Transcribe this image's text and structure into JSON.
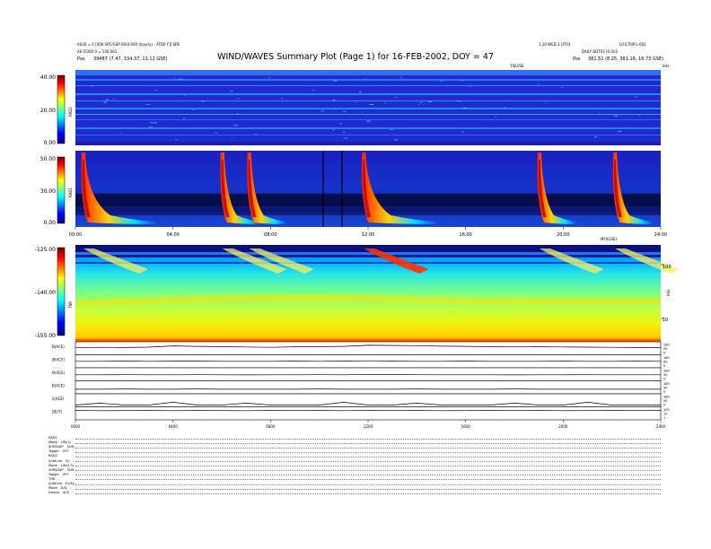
{
  "header": {
    "left_line1": "A036 = 0 [000 SPC/GSP 00(0 000 (hourly) - ATD0 F][ SPE",
    "left_line2": "A0 [F000 0 = 136.061",
    "left_pos_label": "Pos",
    "left_pos_value": "39487 (7.47, 334.37, 11.12 GSE)",
    "title": "WIND/WAVES Summary Plot (Page 1) for 16-FEB-2002, DOY = 47",
    "right_line1": "1.10 WED 3 UT03",
    "right_line1b": "L0 E700Fu 601",
    "right_line2": "DAILY BDT03 [0.0(i2",
    "right_pos_label": "Pos",
    "right_pos_value": "381.51 (8.25, 381.16, 16.73 GSE)",
    "units_label": "TIEU/SE",
    "unit_right": "kHz"
  },
  "footer_rows": [
    {
      "label": "RAD1",
      "value": ""
    },
    {
      "label": "Mode",
      "value": "LIN(1)"
    },
    {
      "label": "SUM/DAP",
      "value": "SUM"
    },
    {
      "label": "Toggle",
      "value": "OFF"
    },
    {
      "label": "RAD2",
      "value": ""
    },
    {
      "label": "Antenna",
      "value": "Ey"
    },
    {
      "label": "Mode",
      "value": "LIN(2,3)"
    },
    {
      "label": "SUM/DAP",
      "value": "SUM"
    },
    {
      "label": "Toggle",
      "value": "OFF"
    },
    {
      "label": "TNR",
      "value": ""
    },
    {
      "label": "Antenna",
      "value": "Ex/Ey"
    },
    {
      "label": "Mode",
      "value": "A/D"
    },
    {
      "label": "Sweep",
      "value": "ACE"
    }
  ],
  "chart_data": [
    {
      "type": "heatmap",
      "name": "RAD2",
      "panel_label": "RAD2",
      "colorbar_ticks": [
        "40.00",
        "20.00",
        "0.00"
      ],
      "colorbar_range": [
        0,
        40
      ],
      "grid": false
    },
    {
      "type": "heatmap",
      "name": "RAD1",
      "panel_label": "RAD1",
      "colorbar_ticks": [
        "50.00",
        "30.00",
        "0.00"
      ],
      "colorbar_range": [
        0,
        50
      ],
      "x_tick_labels": [
        "00:00",
        "04:00",
        "08:00",
        "12:00",
        "16:00",
        "20:00",
        "24:00"
      ],
      "xlabel": "",
      "type_bursts_hours": [
        0.4,
        6.1,
        7.2,
        11.9,
        19.1,
        22.2
      ],
      "grid": false
    },
    {
      "type": "heatmap",
      "name": "TNR",
      "panel_label": "TNR",
      "colorbar_ticks": [
        "-125.00",
        "-140.00",
        "-155.00"
      ],
      "colorbar_range": [
        -155,
        -125
      ],
      "right_axis_ticks": [
        "100",
        "10"
      ],
      "right_axis_label": "kHz",
      "top_label": "MFI(GSE)",
      "grid": false
    },
    {
      "type": "line",
      "name": "magnetometer",
      "x_tick_labels": [
        "0000",
        "0400",
        "0800",
        "1200",
        "1600",
        "2000",
        "2400"
      ],
      "series": [
        {
          "name": "B(ACE)",
          "right_ticks": [
            "180",
            "90",
            "0"
          ],
          "values": [
            0.55,
            0.6,
            0.58,
            0.62,
            0.75,
            0.7,
            0.68,
            0.64,
            0.6,
            0.66,
            0.68,
            0.7,
            0.82,
            0.8,
            0.78,
            0.72,
            0.7,
            0.68,
            0.65,
            0.66,
            0.64,
            0.62,
            0.6,
            0.58,
            0.58
          ]
        },
        {
          "name": "Ø(ACE)",
          "right_ticks": [
            "180",
            "90",
            "0"
          ],
          "values": [
            0.5,
            0.5,
            0.52,
            0.5,
            0.51,
            0.52,
            0.5,
            0.5,
            0.5,
            0.52,
            0.5,
            0.52,
            0.55,
            0.52,
            0.5,
            0.5,
            0.52,
            0.5,
            0.5,
            0.5,
            0.52,
            0.5,
            0.5,
            0.52,
            0.5
          ]
        },
        {
          "name": "Θ(ACE)",
          "right_ticks": [
            "180",
            "90",
            "0"
          ],
          "values": [
            0.45,
            0.45,
            0.46,
            0.45,
            0.45,
            0.46,
            0.45,
            0.44,
            0.45,
            0.45,
            0.46,
            0.45,
            0.5,
            0.48,
            0.46,
            0.45,
            0.45,
            0.45,
            0.44,
            0.45,
            0.45,
            0.46,
            0.45,
            0.45,
            0.45
          ]
        },
        {
          "name": "B(ACE)",
          "right_ticks": [
            "180",
            "90",
            "0"
          ],
          "values": [
            0.3,
            0.3,
            0.32,
            0.3,
            0.3,
            0.32,
            0.3,
            0.3,
            0.3,
            0.3,
            0.32,
            0.3,
            0.3,
            0.3,
            0.32,
            0.3,
            0.3,
            0.3,
            0.32,
            0.3,
            0.3,
            0.3,
            0.3,
            0.3,
            0.3
          ]
        },
        {
          "name": "λ(ACE)",
          "right_ticks": [
            "180",
            "90",
            "0"
          ],
          "values": [
            0.0,
            0.2,
            0.0,
            0.0,
            0.3,
            0.0,
            0.0,
            0.2,
            0.0,
            0.0,
            0.0,
            0.3,
            0.0,
            0.0,
            0.2,
            0.0,
            0.0,
            0.0,
            0.2,
            0.0,
            0.0,
            0.3,
            0.0,
            0.0,
            0.0
          ]
        },
        {
          "name": "|B|(T)",
          "right_ticks": [
            "100",
            "10",
            "1"
          ],
          "values": [
            0.8,
            0.78,
            0.79,
            0.8,
            0.78,
            0.8,
            0.79,
            0.78,
            0.8,
            0.79,
            0.8,
            0.78,
            0.8,
            0.79,
            0.8,
            0.78,
            0.79,
            0.8,
            0.79,
            0.8,
            0.78,
            0.79,
            0.8,
            0.79,
            0.8
          ]
        }
      ]
    }
  ]
}
